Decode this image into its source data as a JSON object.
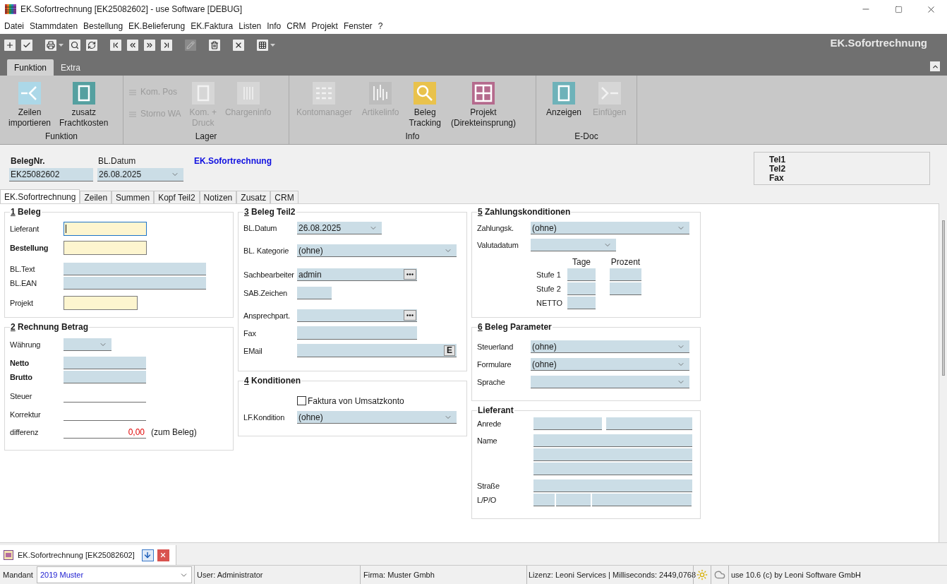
{
  "window": {
    "title": "EK.Sofortrechnung [EK25082602] - use Software [DEBUG]"
  },
  "menu": [
    "Datei",
    "Stammdaten",
    "Bestellung",
    "EK.Belieferung",
    "EK.Faktura",
    "Listen",
    "Info",
    "CRM",
    "Projekt",
    "Fenster",
    "?"
  ],
  "toolbar": {
    "items": [
      {
        "kind": "add",
        "disabled": false
      },
      {
        "kind": "save",
        "disabled": false
      },
      {
        "kind": "print",
        "disabled": false
      },
      {
        "kind": "search",
        "disabled": false
      },
      {
        "kind": "refresh",
        "disabled": false
      },
      {
        "kind": "first",
        "disabled": false
      },
      {
        "kind": "previous",
        "disabled": false
      },
      {
        "kind": "next",
        "disabled": false
      },
      {
        "kind": "last",
        "disabled": false
      },
      {
        "kind": "edit",
        "disabled": true
      },
      {
        "kind": "delete",
        "disabled": false
      },
      {
        "kind": "cancel",
        "disabled": false
      },
      {
        "kind": "grid",
        "disabled": false
      }
    ],
    "heading": "EK.Sofortrechnung"
  },
  "ribbon": {
    "tabs": [
      {
        "label": "Funktion",
        "selected": true
      },
      {
        "label": "Extra",
        "selected": false
      }
    ],
    "groups": [
      {
        "label": "Funktion",
        "items": [
          {
            "kind": "import",
            "label": "Zeilen\nimportieren",
            "disabled": false,
            "color": "#acd8e8"
          },
          {
            "kind": "frame",
            "label": "zusatz\nFrachtkosten",
            "disabled": false,
            "color": "#55a0a0"
          }
        ]
      },
      {
        "label": "Lager",
        "items": [
          {
            "kind": "stack",
            "items": [
              {
                "label": "Kom. Pos",
                "disabled": true
              },
              {
                "label": "Storno WA",
                "disabled": true
              }
            ]
          },
          {
            "kind": "frame",
            "label": "Kom. +\nDruck",
            "disabled": true,
            "color": "#d6d6d6"
          },
          {
            "kind": "columns",
            "label": "Chargeninfo",
            "disabled": true,
            "color": "#d6d6d6"
          }
        ]
      },
      {
        "label": "Info",
        "items": [
          {
            "kind": "list",
            "label": "Kontomanager",
            "disabled": true,
            "color": "#d6d6d6"
          },
          {
            "kind": "bars",
            "label": "Artikelinfo",
            "disabled": true,
            "color": "#bdbdbd"
          },
          {
            "kind": "search",
            "label": "Beleg\nTracking",
            "disabled": false,
            "color": "#e9c24c"
          },
          {
            "kind": "window",
            "label": "Projekt\n(Direkteinsprung)",
            "disabled": false,
            "color": "#b56a8d"
          }
        ]
      },
      {
        "label": "E-Doc",
        "items": [
          {
            "kind": "frame",
            "label": "Anzeigen",
            "disabled": false,
            "color": "#6eb2b9"
          },
          {
            "kind": "insert",
            "label": "Einfügen",
            "disabled": true,
            "color": "#d6d6d6"
          }
        ]
      }
    ]
  },
  "header": {
    "number": {
      "label": "BelegNr.",
      "value": "EK25082602"
    },
    "date": {
      "label": "BL.Datum",
      "value": "26.08.2025"
    },
    "document_type": "EK.Sofortrechnung",
    "contact": [
      "Tel1",
      "Tel2",
      "Fax"
    ]
  },
  "tabs": [
    {
      "label": "EK.Sofortrechnung",
      "selected": true
    },
    {
      "label": "Zeilen",
      "selected": false
    },
    {
      "label": "Summen",
      "selected": false
    },
    {
      "label": "Kopf Teil2",
      "selected": false
    },
    {
      "label": "Notizen",
      "selected": false
    },
    {
      "label": "Zusatz",
      "selected": false
    },
    {
      "label": "CRM",
      "selected": false
    }
  ],
  "groups": [
    {
      "number": "1",
      "title": "Beleg",
      "rows": [
        {
          "label": "Lieferant",
          "bold": false,
          "fields": [
            {
              "kind": "required",
              "focused": true
            }
          ]
        },
        {
          "label": "Bestellung",
          "bold": true,
          "fields": [
            {
              "kind": "required",
              "focused": false
            }
          ]
        },
        {
          "label": "BL.Text",
          "bold": false,
          "fields": [
            {
              "kind": "text"
            }
          ]
        },
        {
          "label": "BL.EAN",
          "bold": false,
          "fields": [
            {
              "kind": "text"
            }
          ]
        },
        {
          "label": "Projekt",
          "bold": false,
          "fields": [
            {
              "kind": "required",
              "focused": false
            }
          ]
        }
      ]
    },
    {
      "number": "2",
      "title": "Rechnung Betrag",
      "rows": [
        {
          "label": "Währung",
          "bold": false,
          "fields": [
            {
              "kind": "combo"
            }
          ]
        },
        {
          "label": "Netto",
          "bold": true,
          "fields": [
            {
              "kind": "text"
            }
          ]
        },
        {
          "label": "Brutto",
          "bold": true,
          "fields": [
            {
              "kind": "text"
            }
          ]
        },
        {
          "label": "Steuer",
          "bold": false,
          "fields": [
            {
              "kind": "line"
            }
          ]
        },
        {
          "label": "Korrektur",
          "bold": false,
          "fields": [
            {
              "kind": "line"
            }
          ]
        },
        {
          "label": "differenz",
          "bold": false,
          "fields": [
            {
              "kind": "total",
              "value": "0,00"
            }
          ],
          "suffix": "(zum Beleg)"
        }
      ]
    },
    {
      "number": "3",
      "title": "Beleg Teil2",
      "rows": [
        {
          "label": "BL.Datum",
          "fields": [
            {
              "kind": "combo",
              "value": "26.08.2025"
            }
          ]
        },
        {
          "label": "BL. Kategorie",
          "fields": [
            {
              "kind": "combo",
              "value": "(ohne)"
            }
          ]
        },
        {
          "label": "Sachbearbeiter",
          "fields": [
            {
              "kind": "lookup",
              "value": "admin"
            }
          ]
        },
        {
          "label": "SAB.Zeichen",
          "fields": [
            {
              "kind": "text"
            }
          ]
        },
        {
          "label": "Ansprechpart.",
          "fields": [
            {
              "kind": "lookup"
            }
          ]
        },
        {
          "label": "Fax",
          "fields": [
            {
              "kind": "text"
            }
          ]
        },
        {
          "label": "EMail",
          "fields": [
            {
              "kind": "email",
              "button": "E"
            }
          ]
        }
      ]
    },
    {
      "number": "4",
      "title": "Konditionen",
      "rows": [
        {
          "kind": "checkbox",
          "label": "Faktura von Umsatzkonto",
          "checked": false
        },
        {
          "kind": "field",
          "label": "LF.Kondition",
          "fields": [
            {
              "kind": "combo",
              "value": "(ohne)"
            }
          ]
        }
      ]
    },
    {
      "number": "5",
      "title": "Zahlungskonditionen",
      "rows": [
        {
          "kind": "field",
          "label": "Zahlungsk.",
          "fields": [
            {
              "kind": "combo",
              "value": "(ohne)"
            }
          ]
        },
        {
          "kind": "field",
          "label": "Valutadatum",
          "fields": [
            {
              "kind": "combo"
            }
          ]
        },
        {
          "kind": "tier_header",
          "columns": [
            "Tage",
            "Prozent"
          ]
        },
        {
          "kind": "tier",
          "label": "Stufe 1",
          "fields": [
            {
              "kind": "text"
            },
            {
              "kind": "text"
            }
          ]
        },
        {
          "kind": "tier",
          "label": "Stufe 2",
          "fields": [
            {
              "kind": "text"
            },
            {
              "kind": "text"
            }
          ]
        },
        {
          "kind": "tier",
          "label": "NETTO",
          "fields": [
            {
              "kind": "text"
            }
          ]
        }
      ]
    },
    {
      "number": "6",
      "title": "Beleg Parameter",
      "rows": [
        {
          "label": "Steuerland",
          "fields": [
            {
              "kind": "combo",
              "value": "(ohne)"
            }
          ]
        },
        {
          "label": "Formulare",
          "fields": [
            {
              "kind": "combo",
              "value": "(ohne)"
            }
          ]
        },
        {
          "label": "Sprache",
          "fields": [
            {
              "kind": "combo"
            }
          ]
        }
      ]
    },
    {
      "title": "Lieferant",
      "rows": [
        {
          "label": "Anrede",
          "fields": [
            {
              "kind": "text"
            },
            {
              "kind": "text"
            }
          ]
        },
        {
          "label": "Name",
          "fields": [
            {
              "kind": "text"
            },
            {
              "kind": "text"
            },
            {
              "kind": "text"
            }
          ]
        },
        {
          "label": "Straße",
          "fields": [
            {
              "kind": "text"
            }
          ]
        },
        {
          "label": "L/P/O",
          "fields": [
            {
              "kind": "text"
            },
            {
              "kind": "text"
            },
            {
              "kind": "text"
            }
          ]
        }
      ]
    }
  ],
  "document_tabs": [
    {
      "label": "EK.Sofortrechnung [EK25082602]",
      "selected": true
    }
  ],
  "status_bar": {
    "mandant_label": "Mandant",
    "mandant": "2019 Muster",
    "user": "User: Administrator",
    "firma": "Firma: Muster Gmbh",
    "lizenz": "Lizenz: Leoni Services | Milliseconds: 2449,0768",
    "version": "use 10.6 (c) by Leoni Software GmbH"
  }
}
